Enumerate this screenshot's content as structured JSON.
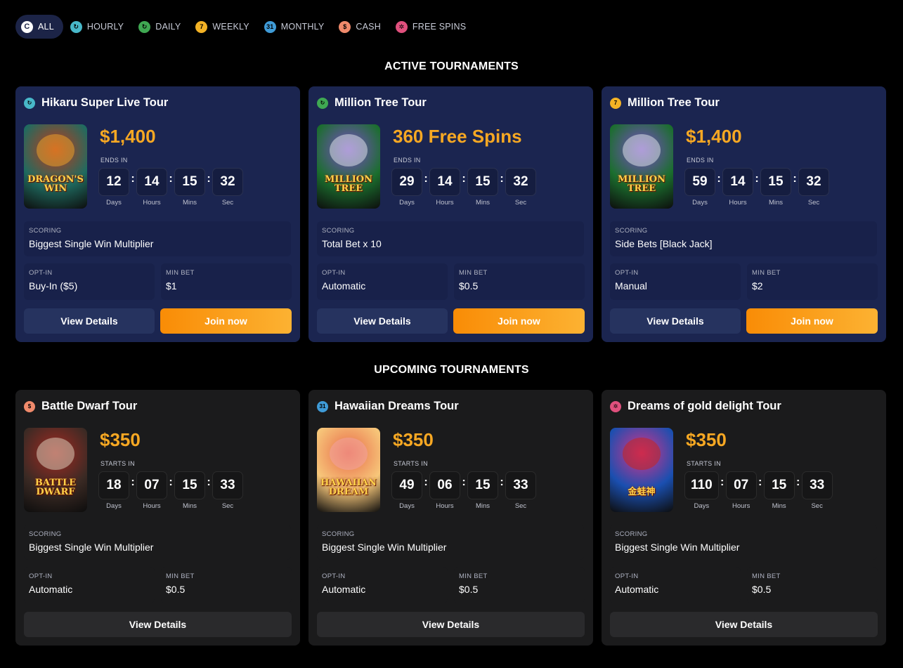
{
  "filters": [
    {
      "label": "ALL",
      "icon": "all-icon",
      "color": "#ffffff",
      "glyph": "C"
    },
    {
      "label": "HOURLY",
      "icon": "hourly-icon",
      "color": "#48b8c9",
      "glyph": "↻"
    },
    {
      "label": "DAILY",
      "icon": "daily-icon",
      "color": "#3fa852",
      "glyph": "↻"
    },
    {
      "label": "WEEKLY",
      "icon": "weekly-icon",
      "color": "#f3b225",
      "glyph": "7"
    },
    {
      "label": "MONTHLY",
      "icon": "monthly-icon",
      "color": "#3f9bd7",
      "glyph": "31"
    },
    {
      "label": "CASH",
      "icon": "cash-icon",
      "color": "#f08a6b",
      "glyph": "$"
    },
    {
      "label": "FREE SPINS",
      "icon": "free-spins-icon",
      "color": "#e0507d",
      "glyph": "✲"
    }
  ],
  "active_title": "ACTIVE TOURNAMENTS",
  "upcoming_title": "UPCOMING TOURNAMENTS",
  "labels": {
    "ends_in": "ENDS IN",
    "starts_in": "STARTS IN",
    "days": "Days",
    "hours": "Hours",
    "mins": "Mins",
    "sec": "Sec",
    "scoring": "SCORING",
    "opt_in": "OPT-IN",
    "min_bet": "MIN BET",
    "view_details": "View Details",
    "join_now": "Join now"
  },
  "active": [
    {
      "title": "Hikaru Super Live Tour",
      "icon": "hourly-icon",
      "icon_color": "#48b8c9",
      "glyph": "↻",
      "game_label": "Dragon's Win",
      "thumb_colors": [
        "#1f6b60",
        "#c23a1a",
        "#e8a12b"
      ],
      "prize": "$1,400",
      "days": "12",
      "hours": "14",
      "mins": "15",
      "sec": "32",
      "scoring": "Biggest Single Win Multiplier",
      "opt_in": "Buy-In ($5)",
      "min_bet": "$1"
    },
    {
      "title": "Million Tree Tour",
      "icon": "daily-icon",
      "icon_color": "#3fa852",
      "glyph": "↻",
      "game_label": "Million Tree",
      "thumb_colors": [
        "#1b6e2e",
        "#7c4bc9",
        "#d8e0e6"
      ],
      "prize": "360 Free Spins",
      "days": "29",
      "hours": "14",
      "mins": "15",
      "sec": "32",
      "scoring": "Total Bet x 10",
      "opt_in": "Automatic",
      "min_bet": "$0.5"
    },
    {
      "title": "Million Tree Tour",
      "icon": "weekly-icon",
      "icon_color": "#f3b225",
      "glyph": "7",
      "game_label": "Million Tree",
      "thumb_colors": [
        "#1b6e2e",
        "#7c4bc9",
        "#d8e0e6"
      ],
      "prize": "$1,400",
      "days": "59",
      "hours": "14",
      "mins": "15",
      "sec": "32",
      "scoring": "Side Bets [Black Jack]",
      "opt_in": "Manual",
      "min_bet": "$2"
    }
  ],
  "upcoming": [
    {
      "title": "Battle Dwarf Tour",
      "icon": "cash-icon",
      "icon_color": "#f08a6b",
      "glyph": "$",
      "game_label": "Battle Dwarf",
      "thumb_colors": [
        "#3b2a24",
        "#a42a22",
        "#d9c9b6"
      ],
      "prize": "$350",
      "days": "18",
      "hours": "07",
      "mins": "15",
      "sec": "33",
      "scoring": "Biggest Single Win Multiplier",
      "opt_in": "Automatic",
      "min_bet": "$0.5"
    },
    {
      "title": "Hawaiian Dreams Tour",
      "icon": "monthly-icon",
      "icon_color": "#3f9bd7",
      "glyph": "31",
      "game_label": "Hawaiian Dream",
      "thumb_colors": [
        "#f7c77a",
        "#e86a4a",
        "#f3a2a0"
      ],
      "prize": "$350",
      "days": "49",
      "hours": "06",
      "mins": "15",
      "sec": "33",
      "scoring": "Biggest Single Win Multiplier",
      "opt_in": "Automatic",
      "min_bet": "$0.5"
    },
    {
      "title": "Dreams of gold delight Tour",
      "icon": "free-spins-icon",
      "icon_color": "#e0507d",
      "glyph": "✲",
      "game_label": "金蛙神",
      "thumb_colors": [
        "#1a4fb0",
        "#d6338a",
        "#c7241e"
      ],
      "prize": "$350",
      "days": "110",
      "hours": "07",
      "mins": "15",
      "sec": "33",
      "scoring": "Biggest Single Win Multiplier",
      "opt_in": "Automatic",
      "min_bet": "$0.5"
    }
  ]
}
